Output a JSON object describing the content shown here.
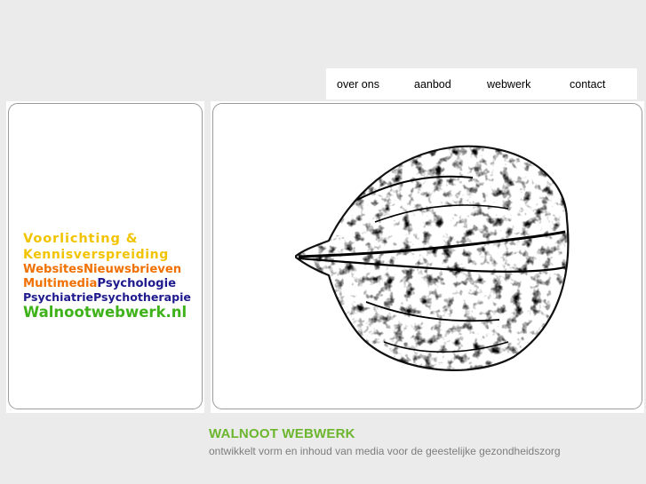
{
  "nav": {
    "items": [
      {
        "label": "over ons"
      },
      {
        "label": "aanbod"
      },
      {
        "label": "webwerk"
      },
      {
        "label": "contact"
      }
    ]
  },
  "promo": {
    "line1": "Voorlichting &",
    "line2": "Kennisverspreiding",
    "line3_a": "Websites",
    "line3_b": "Nieuwsbrieven",
    "line4_a": "Multimedia",
    "line4_b": "Psychologie",
    "line5": "PsychiatriePsychotherapie",
    "line6": "Walnootwebwerk.nl"
  },
  "footer": {
    "title": "WALNOOT WEBWERK",
    "subtitle": "ontwikkelt vorm en inhoud van media voor de geestelijke gezondheidszorg"
  },
  "colors": {
    "background": "#ebebeb",
    "yellow": "#f2c400",
    "orange": "#f07000",
    "navy": "#1f1a8e",
    "green": "#3fb21a",
    "title_green": "#6bb62d"
  }
}
